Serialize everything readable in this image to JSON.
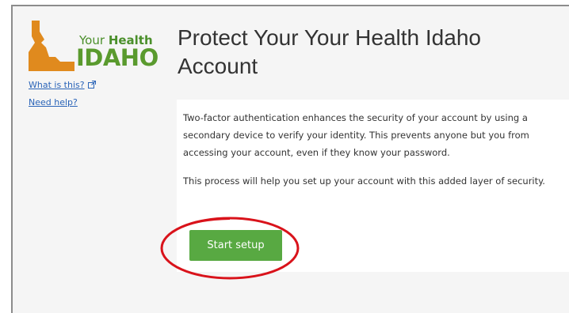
{
  "sidebar": {
    "logo": {
      "word_your": "Your",
      "word_health": "Health",
      "word_idaho": "IDAHO",
      "colors": {
        "state_shape": "#e08a1e",
        "text_green": "#5a9a2e"
      }
    },
    "links": [
      {
        "label": "What is this?",
        "icon": "external-link-icon"
      },
      {
        "label": "Need help?"
      }
    ]
  },
  "main": {
    "title": "Protect Your Your Health Idaho Account",
    "paragraphs": [
      "Two-factor authentication enhances the security of your account by using a secondary device to verify your identity. This prevents anyone but you from accessing your account, even if they know your password.",
      "This process will help you set up your account with this added layer of security."
    ],
    "start_button_label": "Start setup"
  },
  "colors": {
    "button": "#58a942",
    "link": "#2a64b8",
    "annotation": "#d9131b",
    "panel_bg": "#f5f5f5"
  }
}
